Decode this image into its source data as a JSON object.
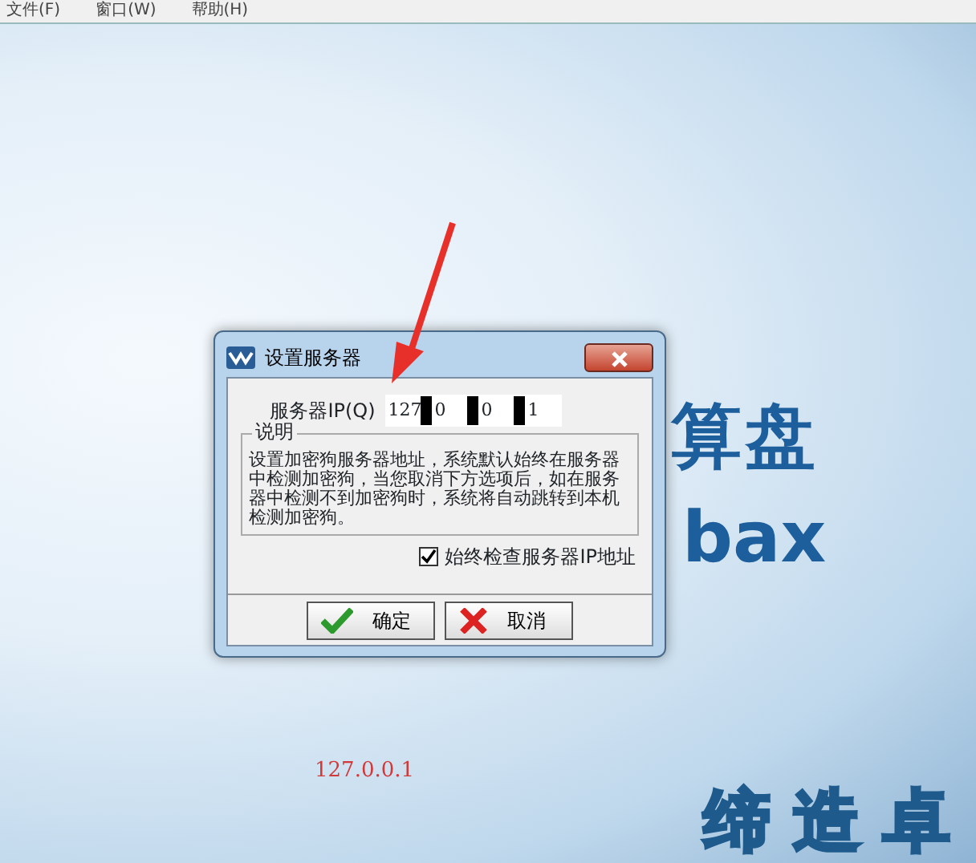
{
  "menu_bar": {
    "items": [
      "文件(F)",
      "窗口(W)",
      "帮助(H)"
    ]
  },
  "splash": {
    "logo_text_1": "算盘",
    "logo_text_2": "bax",
    "slogan": "缔造卓",
    "server_address": "127.0.0.1"
  },
  "dialog": {
    "title": "设置服务器",
    "ip_label": "服务器IP(Q)",
    "ip_segments": [
      "127",
      "0",
      "0",
      "1"
    ],
    "group_title": "说明",
    "description": "设置加密狗服务器地址，系统默认始终在服务器中检测加密狗，当您取消下方选项后，如在服务器中检测不到加密狗时，系统将自动跳转到本机检测加密狗。",
    "checkbox": {
      "label": "始终检查服务器IP地址",
      "checked": true
    },
    "buttons": [
      {
        "kind": "ok",
        "label": "确定"
      },
      {
        "kind": "cancel",
        "label": "取消"
      }
    ]
  }
}
